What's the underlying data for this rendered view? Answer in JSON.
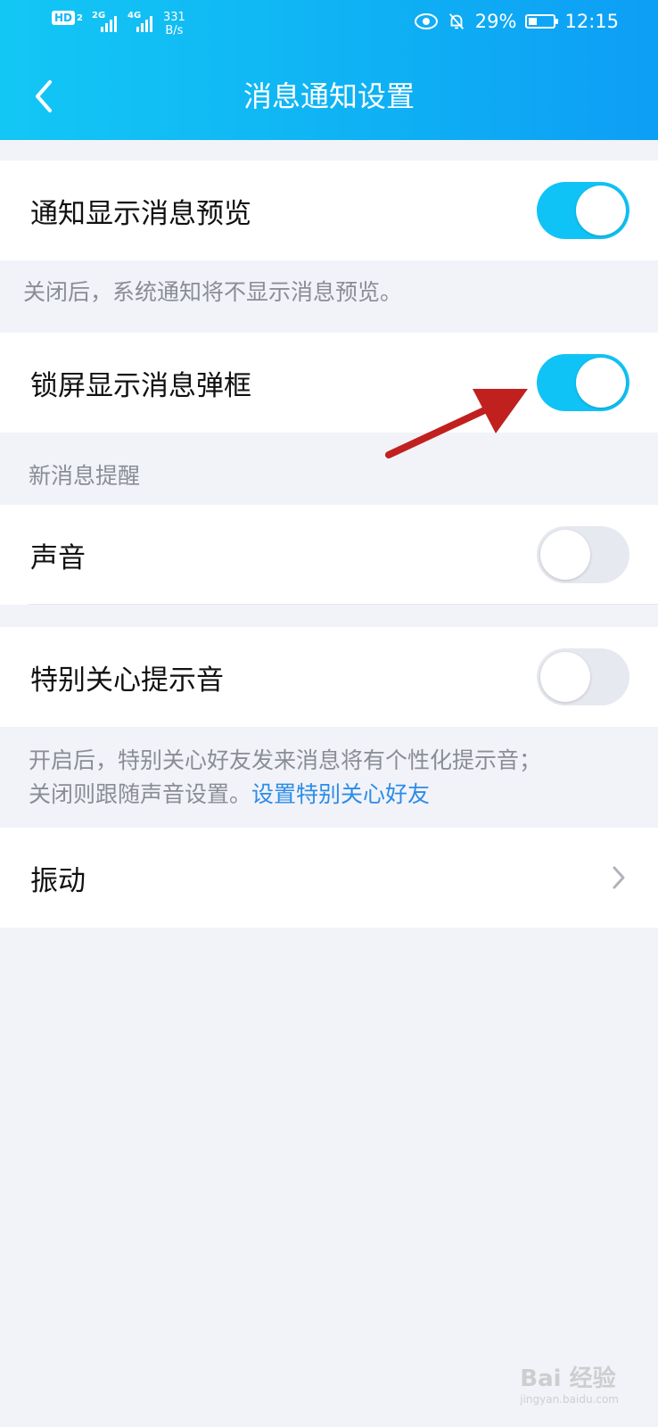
{
  "status_bar": {
    "hd_label": "HD",
    "sim1_label": "2",
    "sig1_label": "2G",
    "sig2_label": "4G",
    "net_speed_value": "331",
    "net_speed_unit": "B/s",
    "battery_percent": "29%",
    "time": "12:15"
  },
  "header": {
    "title": "消息通知设置",
    "back_icon": "chevron-left-icon"
  },
  "settings": {
    "preview": {
      "label": "通知显示消息预览",
      "enabled": true
    },
    "preview_note": "关闭后，系统通知将不显示消息预览。",
    "lockscreen": {
      "label": "锁屏显示消息弹框",
      "enabled": true
    },
    "new_msg_section": "新消息提醒",
    "sound": {
      "label": "声音",
      "enabled": false
    },
    "special": {
      "label": "特别关心提示音",
      "enabled": false
    },
    "special_note_line1": "开启后，特别关心好友发来消息将有个性化提示音；",
    "special_note_line2": "关闭则跟随声音设置。",
    "special_note_link": "设置特别关心好友",
    "vibrate": {
      "label": "振动",
      "icon": "chevron-right-icon"
    }
  },
  "watermark": {
    "text": "Bai 经验",
    "sub": "jingyan.baidu.com"
  },
  "colors": {
    "accent": "#10c3f6",
    "header_start": "#13c7f5",
    "header_end": "#0d9ef5",
    "link": "#2b8ce8",
    "annotation_arrow": "#c0211f"
  }
}
